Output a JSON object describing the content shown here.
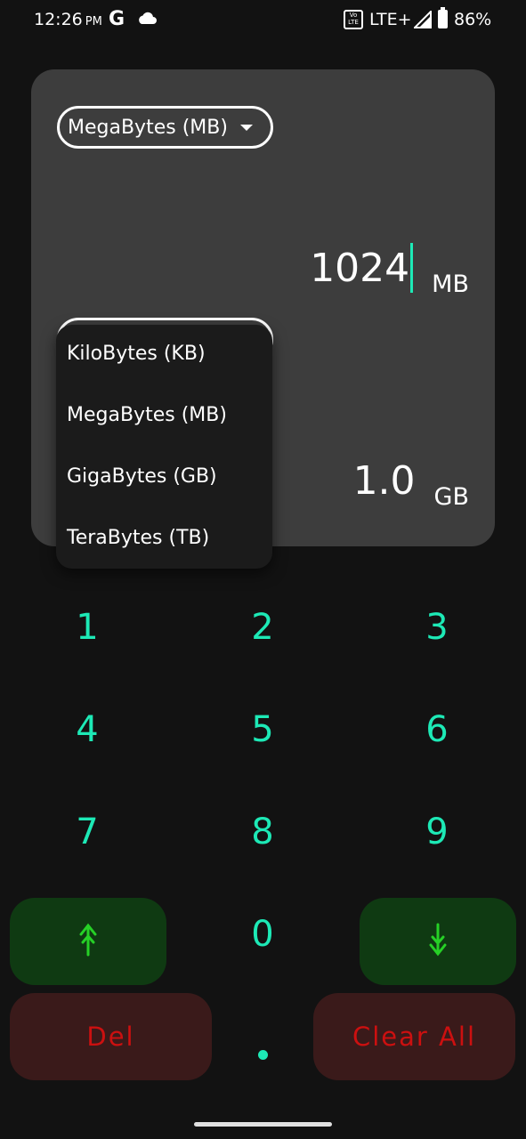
{
  "status_bar": {
    "time": "12:26",
    "ampm": "PM",
    "network": "LTE+",
    "battery": "86%"
  },
  "converter": {
    "from_unit": "MegaBytes (MB)",
    "from_value": "1024",
    "from_unit_short": "MB",
    "to_value": "1.0",
    "to_unit_short": "GB"
  },
  "dropdown": {
    "items": [
      "KiloBytes (KB)",
      "MegaBytes (MB)",
      "GigaBytes (GB)",
      "TeraBytes (TB)"
    ]
  },
  "keypad": {
    "digits": [
      "1",
      "2",
      "3",
      "4",
      "5",
      "6",
      "7",
      "8",
      "9",
      "0"
    ],
    "up_icon": "arrow-up-icon",
    "down_icon": "arrow-down-icon",
    "del_label": "Del",
    "clear_label": "Clear All"
  },
  "colors": {
    "accent": "#1de9b6",
    "card": "#3d3d3d",
    "background": "#121212",
    "arrow_button": "#0f3a12",
    "danger_button": "#3a1a1a",
    "danger_text": "#cc1010"
  }
}
